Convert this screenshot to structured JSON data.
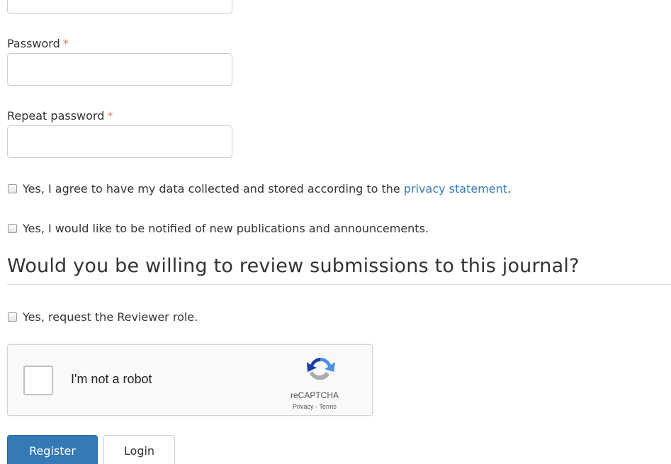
{
  "form": {
    "password": {
      "label": "Password",
      "required_mark": "*",
      "value": ""
    },
    "repeat_password": {
      "label": "Repeat password",
      "required_mark": "*",
      "value": ""
    },
    "privacy_consent": {
      "text": "Yes, I agree to have my data collected and stored according to the",
      "link_text": "privacy statement",
      "suffix": "."
    },
    "notify_consent": {
      "text": "Yes, I would like to be notified of new publications and announcements."
    }
  },
  "reviewer_section": {
    "heading": "Would you be willing to review submissions to this journal?",
    "checkbox_text": "Yes, request the Reviewer role."
  },
  "recaptcha": {
    "label": "I'm not a robot",
    "brand": "reCAPTCHA",
    "privacy_link": "Privacy",
    "separator": " - ",
    "terms_link": "Terms"
  },
  "actions": {
    "register_label": "Register",
    "login_label": "Login"
  },
  "colors": {
    "primary": "#337ab7",
    "link": "#337ab7",
    "required": "#e07a5f"
  }
}
